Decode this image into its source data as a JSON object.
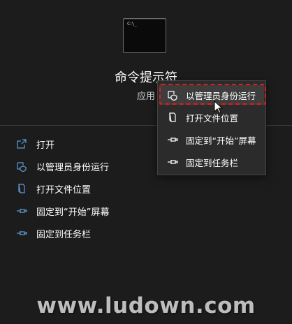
{
  "app": {
    "name": "命令提示符",
    "type": "应用",
    "icon": "command-prompt-icon"
  },
  "actions": [
    {
      "label": "打开",
      "icon": "open-icon"
    },
    {
      "label": "以管理员身份运行",
      "icon": "shield-icon"
    },
    {
      "label": "打开文件位置",
      "icon": "file-location-icon"
    },
    {
      "label": "固定到“开始”屏幕",
      "icon": "pin-icon"
    },
    {
      "label": "固定到任务栏",
      "icon": "pin-icon"
    }
  ],
  "context_menu": {
    "items": [
      {
        "label": "以管理员身份运行",
        "icon": "shield-icon",
        "highlighted": true
      },
      {
        "label": "打开文件位置",
        "icon": "file-location-icon"
      },
      {
        "label": "固定到“开始”屏幕",
        "icon": "pin-icon"
      },
      {
        "label": "固定到任务栏",
        "icon": "pin-icon"
      }
    ]
  },
  "colors": {
    "background": "#1c1c1c",
    "accent_blue": "#5b9bd5",
    "highlight_red": "#e3191e"
  },
  "watermark": "www.ludown.com"
}
